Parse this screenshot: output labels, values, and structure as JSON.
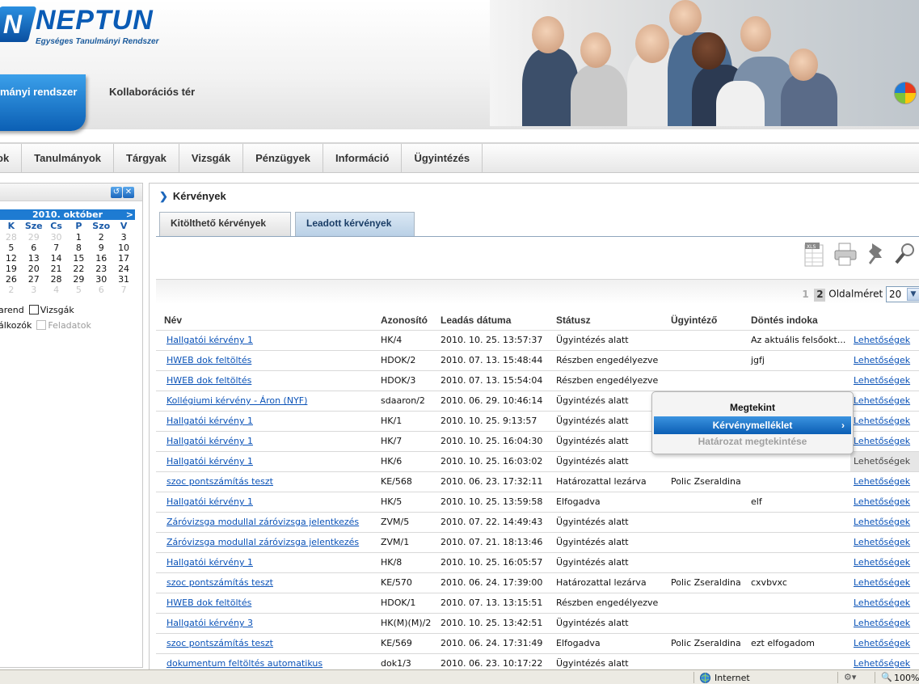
{
  "header": {
    "logo_mark": "N",
    "logo_title": "NEPTUN",
    "logo_subtitle": "Egységes Tanulmányi Rendszer",
    "tab_active": "mányi rendszer",
    "tab_collab": "Kollaborációs tér"
  },
  "menu": [
    "ok",
    "Tanulmányok",
    "Tárgyak",
    "Vizsgák",
    "Pénzügyek",
    "Információ",
    "Ügyintézés"
  ],
  "calendar": {
    "title": "2010. október",
    "next": ">",
    "weekdays": [
      "K",
      "Sze",
      "Cs",
      "P",
      "Szo",
      "V"
    ],
    "weeks": [
      [
        {
          "d": "28",
          "o": true
        },
        {
          "d": "29",
          "o": true
        },
        {
          "d": "30",
          "o": true
        },
        {
          "d": "1"
        },
        {
          "d": "2"
        },
        {
          "d": "3"
        }
      ],
      [
        {
          "d": "5"
        },
        {
          "d": "6"
        },
        {
          "d": "7"
        },
        {
          "d": "8"
        },
        {
          "d": "9"
        },
        {
          "d": "10"
        }
      ],
      [
        {
          "d": "12"
        },
        {
          "d": "13"
        },
        {
          "d": "14"
        },
        {
          "d": "15"
        },
        {
          "d": "16"
        },
        {
          "d": "17"
        }
      ],
      [
        {
          "d": "19"
        },
        {
          "d": "20"
        },
        {
          "d": "21"
        },
        {
          "d": "22"
        },
        {
          "d": "23"
        },
        {
          "d": "24"
        }
      ],
      [
        {
          "d": "26"
        },
        {
          "d": "27"
        },
        {
          "d": "28"
        },
        {
          "d": "29"
        },
        {
          "d": "30"
        },
        {
          "d": "31"
        }
      ],
      [
        {
          "d": "2",
          "o": true
        },
        {
          "d": "3",
          "o": true
        },
        {
          "d": "4",
          "o": true
        },
        {
          "d": "5",
          "o": true
        },
        {
          "d": "6",
          "o": true
        },
        {
          "d": "7",
          "o": true
        }
      ]
    ],
    "legend_orarend": "arend",
    "legend_vizsgak": "Vizsgák",
    "legend_talalkozok": "álkozók",
    "legend_feladatok": "Feladatok"
  },
  "main": {
    "title": "Kérvények",
    "tab_fillable": "Kitölthető kérvények",
    "tab_submitted": "Leadott kérvények",
    "pages": [
      "1",
      "2"
    ],
    "page_size_label": "Oldalméret",
    "page_size_value": "20",
    "columns": [
      "Név",
      "Azonosító",
      "Leadás dátuma",
      "Státusz",
      "Ügyintéző",
      "Döntés indoka"
    ],
    "options_label": "Lehetőségek",
    "rows": [
      {
        "name": "Hallgatói kérvény 1",
        "id": "HK/4",
        "date": "2010. 10. 25. 13:57:37",
        "status": "Ügyintézés alatt",
        "officer": "",
        "reason": "Az aktuális felsőokt..."
      },
      {
        "name": "HWEB dok feltöltés",
        "id": "HDOK/2",
        "date": "2010. 07. 13. 15:48:44",
        "status": "Részben engedélyezve",
        "officer": "",
        "reason": "jgfj"
      },
      {
        "name": "HWEB dok feltöltés",
        "id": "HDOK/3",
        "date": "2010. 07. 13. 15:54:04",
        "status": "Részben engedélyezve",
        "officer": "",
        "reason": ""
      },
      {
        "name": "Kollégiumi kérvény - Áron (NYF)",
        "id": "sdaaron/2",
        "date": "2010. 06. 29. 10:46:14",
        "status": "Ügyintézés alatt",
        "officer": "",
        "reason": ""
      },
      {
        "name": "Hallgatói kérvény 1",
        "id": "HK/1",
        "date": "2010. 10. 25. 9:13:57",
        "status": "Ügyintézés alatt",
        "officer": "",
        "reason": ""
      },
      {
        "name": "Hallgatói kérvény 1",
        "id": "HK/7",
        "date": "2010. 10. 25. 16:04:30",
        "status": "Ügyintézés alatt",
        "officer": "",
        "reason": ""
      },
      {
        "name": "Hallgatói kérvény 1",
        "id": "HK/6",
        "date": "2010. 10. 25. 16:03:02",
        "status": "Ügyintézés alatt",
        "officer": "",
        "reason": "",
        "highlight": true
      },
      {
        "name": "szoc pontszámítás teszt",
        "id": "KE/568",
        "date": "2010. 06. 23. 17:32:11",
        "status": "Határozattal lezárva",
        "officer": "Polic Zseraldina",
        "reason": ""
      },
      {
        "name": "Hallgatói kérvény 1",
        "id": "HK/5",
        "date": "2010. 10. 25. 13:59:58",
        "status": "Elfogadva",
        "officer": "",
        "reason": "elf"
      },
      {
        "name": "Záróvizsga modullal záróvizsga jelentkezés",
        "id": "ZVM/5",
        "date": "2010. 07. 22. 14:49:43",
        "status": "Ügyintézés alatt",
        "officer": "",
        "reason": ""
      },
      {
        "name": "Záróvizsga modullal záróvizsga jelentkezés",
        "id": "ZVM/1",
        "date": "2010. 07. 21. 18:13:46",
        "status": "Ügyintézés alatt",
        "officer": "",
        "reason": ""
      },
      {
        "name": "Hallgatói kérvény 1",
        "id": "HK/8",
        "date": "2010. 10. 25. 16:05:57",
        "status": "Ügyintézés alatt",
        "officer": "",
        "reason": ""
      },
      {
        "name": "szoc pontszámítás teszt",
        "id": "KE/570",
        "date": "2010. 06. 24. 17:39:00",
        "status": "Határozattal lezárva",
        "officer": "Polic Zseraldina",
        "reason": "cxvbvxc"
      },
      {
        "name": "HWEB dok feltöltés",
        "id": "HDOK/1",
        "date": "2010. 07. 13. 13:15:51",
        "status": "Részben engedélyezve",
        "officer": "",
        "reason": ""
      },
      {
        "name": "Hallgatói kérvény 3",
        "id": "HK(M)(M)/2",
        "date": "2010. 10. 25. 13:42:51",
        "status": "Ügyintézés alatt",
        "officer": "",
        "reason": ""
      },
      {
        "name": "szoc pontszámítás teszt",
        "id": "KE/569",
        "date": "2010. 06. 24. 17:31:49",
        "status": "Elfogadva",
        "officer": "Polic Zseraldina",
        "reason": "ezt elfogadom"
      },
      {
        "name": "dokumentum feltöltés automatikus",
        "id": "dok1/3",
        "date": "2010. 06. 23. 10:17:22",
        "status": "Ügyintézés alatt",
        "officer": "",
        "reason": ""
      }
    ]
  },
  "popup": {
    "item1": "Megtekint",
    "item2": "Kérvénymelléklet",
    "item2_arrow": "›",
    "item3": "Határozat megtekintése"
  },
  "statusbar": {
    "zone": "Internet",
    "zoom": "100%"
  },
  "colors": {
    "brand": "#0a5bb5",
    "link": "#0b53b8",
    "accent": "#1e7bd2"
  }
}
